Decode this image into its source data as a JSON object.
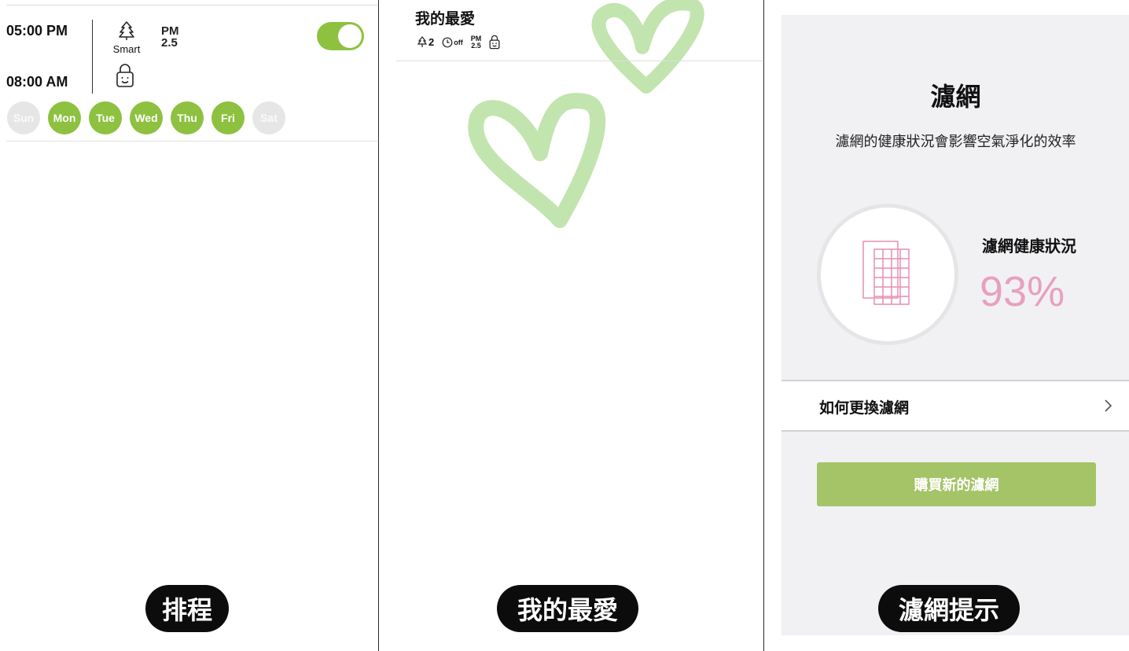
{
  "schedule": {
    "start_time": "05:00 PM",
    "end_time": "08:00 AM",
    "mode_label": "Smart",
    "pm_label_line1": "PM",
    "pm_label_line2": "2.5",
    "enabled": true,
    "days": [
      {
        "label": "Sun",
        "active": false
      },
      {
        "label": "Mon",
        "active": true
      },
      {
        "label": "Tue",
        "active": true
      },
      {
        "label": "Wed",
        "active": true
      },
      {
        "label": "Thu",
        "active": true
      },
      {
        "label": "Fri",
        "active": true
      },
      {
        "label": "Sat",
        "active": false
      }
    ],
    "caption": "排程"
  },
  "favorites": {
    "title": "我的最愛",
    "fan_level": "2",
    "timer_label": "off",
    "pm_line1": "PM",
    "pm_line2": "2.5",
    "caption": "我的最愛"
  },
  "filter": {
    "title": "濾網",
    "subtitle": "濾網的健康狀況會影響空氣淨化的效率",
    "health_label": "濾網健康狀況",
    "health_value": "93%",
    "health_percent": 93,
    "howto_label": "如何更換濾網",
    "buy_label": "購買新的濾網",
    "caption": "濾網提示"
  },
  "colors": {
    "accent_green": "#8dc13f",
    "button_green": "#a4c467",
    "filter_pink": "#e8a0bf",
    "caption_bg": "#0c0c0c"
  },
  "icons": [
    "tree-icon",
    "lock-smile-icon",
    "timer-icon",
    "filter-grid-icon",
    "chevron-right-icon",
    "heart-doodle"
  ]
}
